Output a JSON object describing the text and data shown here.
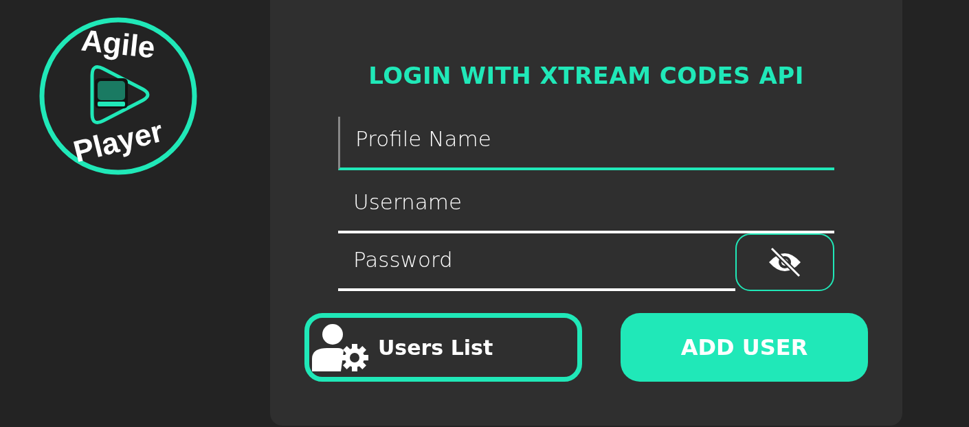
{
  "logo": {
    "top": "Agile",
    "bottom": "Player"
  },
  "title": "LOGIN WITH XTREAM CODES API",
  "fields": [
    {
      "kind": "text",
      "placeholder": "Profile Name",
      "focused": true
    },
    {
      "kind": "text",
      "placeholder": "Username",
      "focused": false
    },
    {
      "kind": "password",
      "placeholder": "Password",
      "focused": false
    }
  ],
  "users_list_button": "Users List",
  "add_user_button": "ADD USER"
}
